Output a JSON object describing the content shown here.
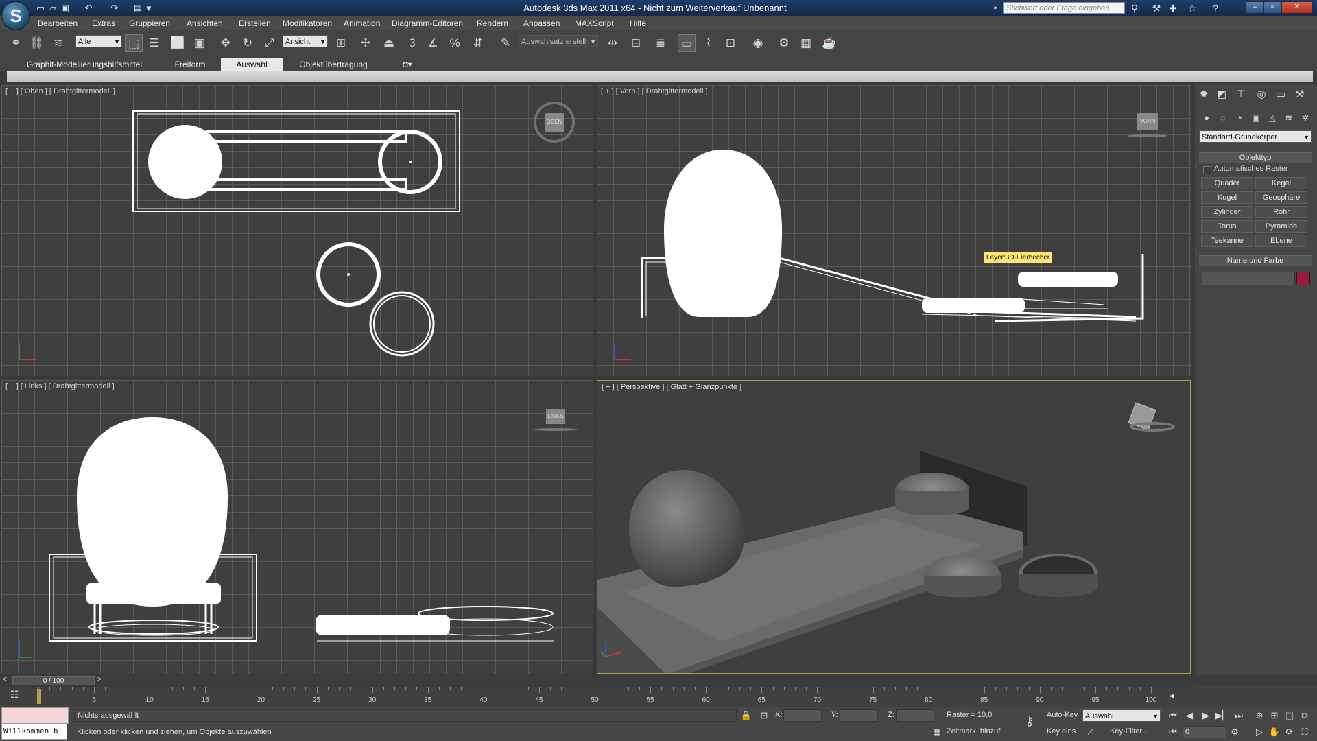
{
  "titlebar": {
    "app_title": "Autodesk 3ds Max  2011 x64  -  Nicht zum Weiterverkauf   Unbenannt",
    "search_placeholder": "Stichwort oder Frage eingeben"
  },
  "menubar": {
    "items": [
      "Bearbeiten",
      "Extras",
      "Gruppieren",
      "Ansichten",
      "Erstellen",
      "Modifikatoren",
      "Animation",
      "Diagramm-Editoren",
      "Rendern",
      "Anpassen",
      "MAXScript",
      "Hilfe"
    ]
  },
  "toolbar": {
    "selection_filter": "Alle",
    "reference_coord": "Ansicht",
    "named_selection": "Auswahlsatz erstell",
    "snap_number": "3"
  },
  "ribbon": {
    "tabs": [
      "Graphit-Modellierungshilfsmittel",
      "Freiform",
      "Auswahl",
      "Objektübertragung"
    ],
    "active_tab": "Auswahl"
  },
  "viewports": {
    "top": {
      "label": "[ + ] [ Oben ] [ Drahtgittermodell ]",
      "cube": "OBEN"
    },
    "front": {
      "label": "[ + ] [ Vorn ] [ Drahtgittermodell ]",
      "cube": "VORN",
      "tooltip": "Layer:3D-Eierbecher"
    },
    "left": {
      "label": "[ + ] [ Links ] [ Drahtgittermodell ]",
      "cube": "LINKS"
    },
    "perspective": {
      "label": "[ + ] [ Perspektive ] [ Glatt + Glanzpunkte ]"
    }
  },
  "command_panel": {
    "category_dropdown": "Standard-Grundkörper",
    "rollout_object_type": "Objekttyp",
    "auto_grid_label": "Automatisches Raster",
    "buttons": [
      "Quader",
      "Kegel",
      "Kugel",
      "Geosphäre",
      "Zylinder",
      "Rohr",
      "Torus",
      "Pyramide",
      "Teekanne",
      "Ebene"
    ],
    "rollout_name_color": "Name und Farbe",
    "name_value": "",
    "color_swatch": "#9b1a3a"
  },
  "timeline": {
    "frame_display": "0 / 100",
    "ticks": [
      "5",
      "10",
      "15",
      "20",
      "25",
      "30",
      "35",
      "40",
      "45",
      "50",
      "55",
      "60",
      "65",
      "70",
      "75",
      "80",
      "85",
      "90",
      "95",
      "100"
    ]
  },
  "status": {
    "maxscript_listener": "Willkommen b",
    "selection_status": "Nichts ausgewählt",
    "prompt": "Klicken oder klicken und ziehen, um Objekte auszuwählen",
    "x_label": "X:",
    "y_label": "Y:",
    "z_label": "Z:",
    "grid": "Raster = 10,0",
    "add_time_tag": "Zeitmark. hinzuf.",
    "auto_key": "Auto-Key",
    "set_key": "Key eins.",
    "key_mode": "Auswahl",
    "key_filters": "Key-Filter...",
    "current_frame": "0"
  }
}
